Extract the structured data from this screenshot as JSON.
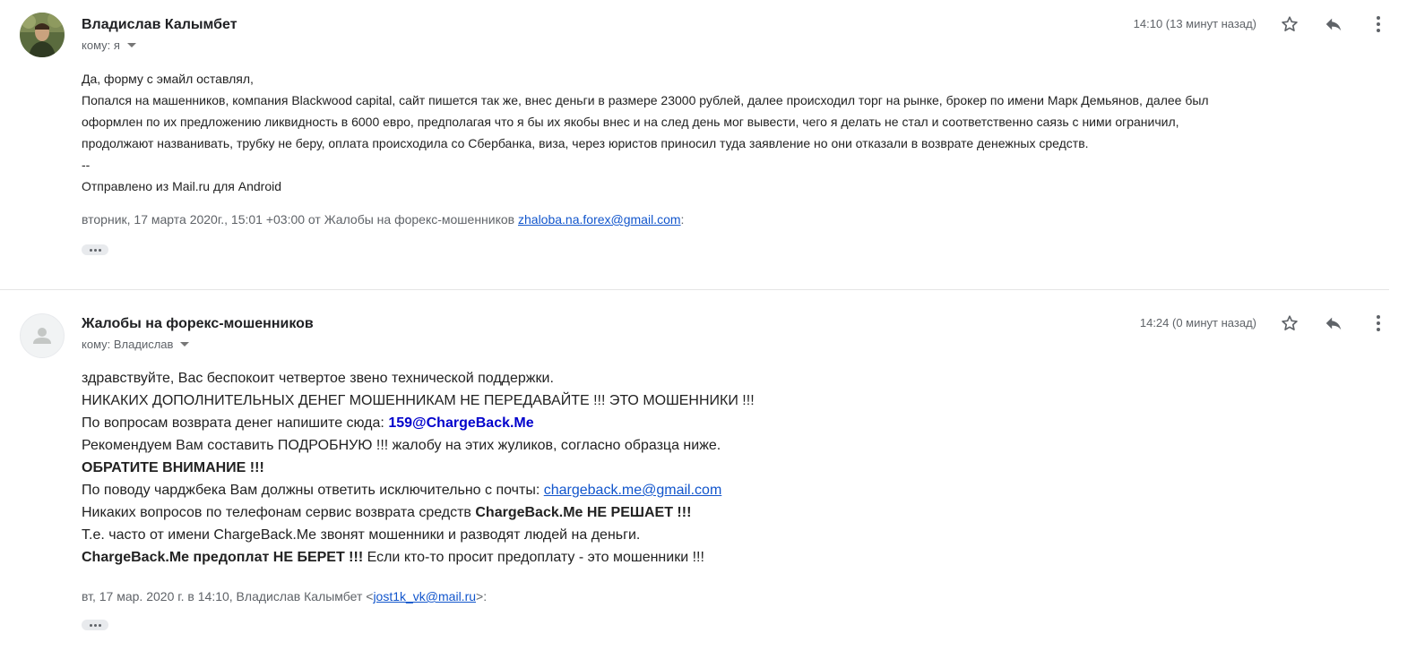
{
  "messages": [
    {
      "sender": "Владислав Калымбет",
      "to_label": "кому: я",
      "time": "14:10 (13 минут назад)",
      "body_lines": [
        "Да, форму с эмайл оставлял,",
        "Попался на машенников, компания Blackwood capital, сайт пишется так же, внес деньги в размере 23000 рублей, далее происходил торг на рынке, брокер по имени Марк Демьянов, далее был",
        "оформлен по их предложению ликвидность в 6000 евро, предполагая что я бы их якобы внес и на след день мог вывести, чего я делать не стал и соответственно саязь с ними ограничил,",
        "продолжают названивать, трубку не беру, оплата происходила со Сбербанка, виза, через юристов приносил туда заявление но они отказали в возврате денежных средств.",
        "--",
        "Отправлено из Mail.ru для Android"
      ],
      "quote_prefix": "вторник, 17 марта 2020г., 15:01 +03:00 от Жалобы на форекс-мошенников",
      "quote_email": "zhaloba.na.forex@gmail.com",
      "quote_suffix": ":"
    },
    {
      "sender": "Жалобы на форекс-мошенников",
      "to_label": "кому: Владислав",
      "time": "14:24 (0 минут назад)",
      "line1": "здравствуйте, Вас беспокоит четвертое звено технической поддержки.",
      "line2": "НИКАКИХ ДОПОЛНИТЕЛЬНЫХ ДЕНЕГ МОШЕННИКАМ НЕ ПЕРЕДАВАЙТЕ !!! ЭТО МОШЕННИКИ !!!",
      "line3_text": "По вопросам возврата денег напишите сюда: ",
      "line3_email": "159@ChargeBack.Me",
      "line4": "Рекомендуем Вам составить ПОДРОБНУЮ !!! жалобу на этих жуликов, согласно образца ниже.",
      "line5": "ОБРАТИТЕ ВНИМАНИЕ !!!",
      "line6_text": "По поводу чарджбека Вам должны ответить исключительно с почты: ",
      "line6_email": "chargeback.me@gmail.com",
      "line7_text": "Никаких вопросов по телефонам сервис возврата средств ",
      "line7_bold": "ChargeBack.Me НЕ РЕШАЕТ !!!",
      "line8": "Т.е. часто от имени ChargeBack.Me звонят мошенники и разводят людей на деньги.",
      "line9_bold": "ChargeBack.Me предоплат НЕ БЕРЕТ !!!",
      "line9_text": " Если кто-то просит предоплату - это мошенники !!!",
      "quote_prefix": "вт, 17 мар. 2020 г. в 14:10, Владислав Калымбет <",
      "quote_email": "jost1k_vk@mail.ru",
      "quote_suffix": ">:"
    }
  ],
  "icons": {
    "star": "star-icon",
    "reply": "reply-icon",
    "more": "more-vert-icon",
    "avatar_placeholder": "person-icon"
  },
  "colors": {
    "link": "#1155cc",
    "highlight_email": "#0000cc",
    "meta": "#5f6368"
  }
}
